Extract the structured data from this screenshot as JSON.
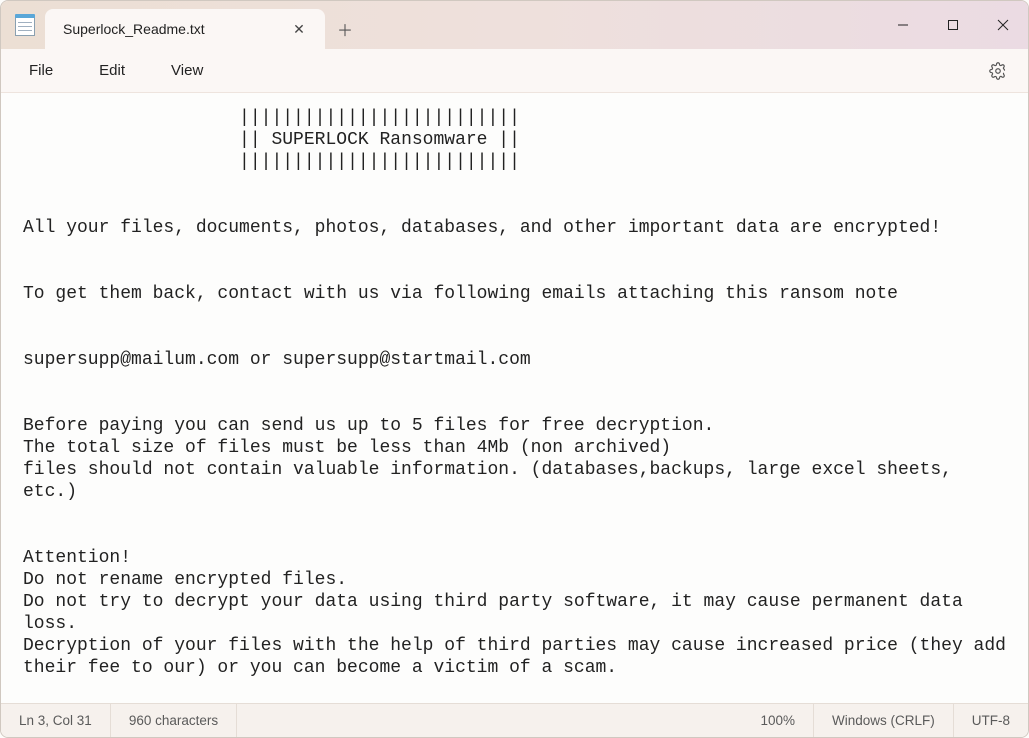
{
  "titlebar": {
    "tab_title": "Superlock_Readme.txt",
    "close_glyph": "✕",
    "newtab_glyph": "＋"
  },
  "menubar": {
    "file": "File",
    "edit": "Edit",
    "view": "View"
  },
  "editor": {
    "content": "                    ||||||||||||||||||||||||||\n                    || SUPERLOCK Ransomware ||\n                    ||||||||||||||||||||||||||\n\n\nAll your files, documents, photos, databases, and other important data are encrypted!\n\n\nTo get them back, contact with us via following emails attaching this ransom note\n\n\nsupersupp@mailum.com or supersupp@startmail.com\n\n\nBefore paying you can send us up to 5 files for free decryption.\nThe total size of files must be less than 4Mb (non archived)\nfiles should not contain valuable information. (databases,backups, large excel sheets, etc.)\n\n\nAttention!\nDo not rename encrypted files.\nDo not try to decrypt your data using third party software, it may cause permanent data loss.\nDecryption of your files with the help of third parties may cause increased price (they add their fee to our) or you can become a victim of a scam.\n\n-------"
  },
  "statusbar": {
    "position": "Ln 3, Col 31",
    "charcount": "960 characters",
    "zoom": "100%",
    "lineending": "Windows (CRLF)",
    "encoding": "UTF-8"
  },
  "icons": {
    "notepad": "notepad-icon",
    "gear": "gear-icon",
    "minimize": "minimize-icon",
    "maximize": "maximize-icon",
    "close": "close-icon"
  }
}
